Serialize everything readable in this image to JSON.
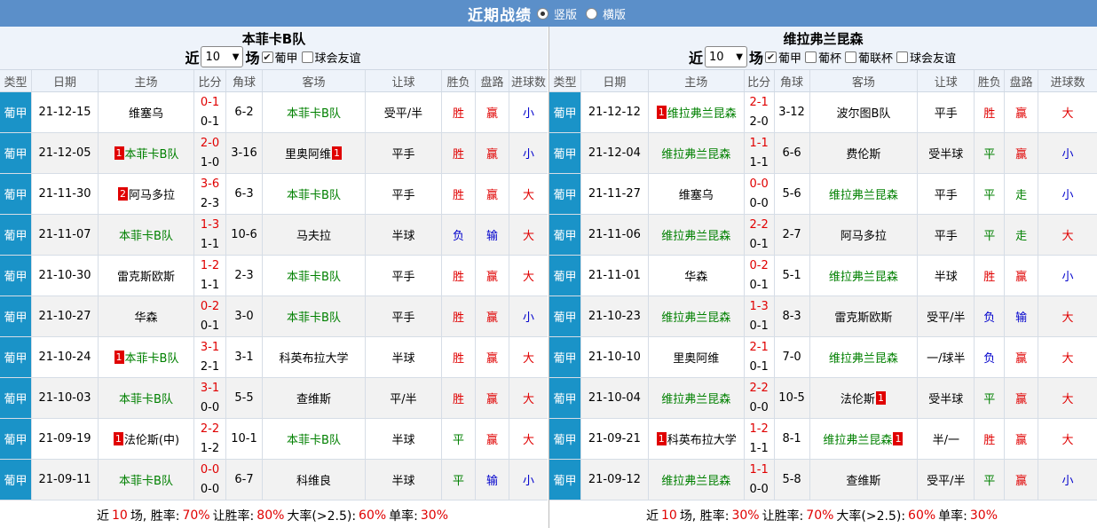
{
  "header": {
    "title": "近期战绩",
    "layout_options": [
      "竖版",
      "横版"
    ],
    "selected_layout": "竖版"
  },
  "colors": {
    "topbar": "#5b8fc9",
    "type_cell": "#1a93c8",
    "red": "#e00000",
    "green": "#008000",
    "blue": "#0000cc"
  },
  "columns": [
    "类型",
    "日期",
    "主场",
    "比分",
    "角球",
    "客场",
    "让球",
    "胜负",
    "盘路",
    "进球数"
  ],
  "left": {
    "team": "本菲卡B队",
    "prefix": "近",
    "count": "10",
    "suffix": "场",
    "filters": [
      {
        "label": "葡甲",
        "checked": true
      },
      {
        "label": "球会友谊",
        "checked": false
      }
    ],
    "rows": [
      {
        "type": "葡甲",
        "date": "21-12-15",
        "home": "维塞乌",
        "home_flag": "",
        "ht": "0-1",
        "ft": "0-1",
        "corner": "6-2",
        "away": "本菲卡B队",
        "away_flag": "",
        "handicap": "受平/半",
        "result": "胜",
        "pan": "赢",
        "goals": "小"
      },
      {
        "type": "葡甲",
        "date": "21-12-05",
        "home": "本菲卡B队",
        "home_flag": "1",
        "ht": "2-0",
        "ft": "1-0",
        "corner": "3-16",
        "away": "里奥阿维",
        "away_flag": "1",
        "handicap": "平手",
        "result": "胜",
        "pan": "赢",
        "goals": "小"
      },
      {
        "type": "葡甲",
        "date": "21-11-30",
        "home": "阿马多拉",
        "home_flag": "2",
        "ht": "3-6",
        "ft": "2-3",
        "corner": "6-3",
        "away": "本菲卡B队",
        "away_flag": "",
        "handicap": "平手",
        "result": "胜",
        "pan": "赢",
        "goals": "大"
      },
      {
        "type": "葡甲",
        "date": "21-11-07",
        "home": "本菲卡B队",
        "home_flag": "",
        "ht": "1-3",
        "ft": "1-1",
        "corner": "10-6",
        "away": "马夫拉",
        "away_flag": "",
        "handicap": "半球",
        "result": "负",
        "pan": "输",
        "goals": "大"
      },
      {
        "type": "葡甲",
        "date": "21-10-30",
        "home": "雷克斯欧斯",
        "home_flag": "",
        "ht": "1-2",
        "ft": "1-1",
        "corner": "2-3",
        "away": "本菲卡B队",
        "away_flag": "",
        "handicap": "平手",
        "result": "胜",
        "pan": "赢",
        "goals": "大"
      },
      {
        "type": "葡甲",
        "date": "21-10-27",
        "home": "华森",
        "home_flag": "",
        "ht": "0-2",
        "ft": "0-1",
        "corner": "3-0",
        "away": "本菲卡B队",
        "away_flag": "",
        "handicap": "平手",
        "result": "胜",
        "pan": "赢",
        "goals": "小"
      },
      {
        "type": "葡甲",
        "date": "21-10-24",
        "home": "本菲卡B队",
        "home_flag": "1",
        "ht": "3-1",
        "ft": "2-1",
        "corner": "3-1",
        "away": "科英布拉大学",
        "away_flag": "",
        "handicap": "半球",
        "result": "胜",
        "pan": "赢",
        "goals": "大"
      },
      {
        "type": "葡甲",
        "date": "21-10-03",
        "home": "本菲卡B队",
        "home_flag": "",
        "ht": "3-1",
        "ft": "0-0",
        "corner": "5-5",
        "away": "查维斯",
        "away_flag": "",
        "handicap": "平/半",
        "result": "胜",
        "pan": "赢",
        "goals": "大"
      },
      {
        "type": "葡甲",
        "date": "21-09-19",
        "home": "法伦斯(中)",
        "home_flag": "1",
        "ht": "2-2",
        "ft": "1-2",
        "corner": "10-1",
        "away": "本菲卡B队",
        "away_flag": "",
        "handicap": "半球",
        "result": "平",
        "pan": "赢",
        "goals": "大"
      },
      {
        "type": "葡甲",
        "date": "21-09-11",
        "home": "本菲卡B队",
        "home_flag": "",
        "ht": "0-0",
        "ft": "0-0",
        "corner": "6-7",
        "away": "科维良",
        "away_flag": "",
        "handicap": "半球",
        "result": "平",
        "pan": "输",
        "goals": "小"
      }
    ],
    "summary": {
      "p1": "近",
      "n": "10",
      "p2": "场, 胜率:",
      "win": "70%",
      "p3": "让胜率:",
      "hwin": "80%",
      "p4": "大率(>2.5):",
      "big": "60%",
      "p5": "单率:",
      "odd": "30%"
    }
  },
  "right": {
    "team": "维拉弗兰昆森",
    "prefix": "近",
    "count": "10",
    "suffix": "场",
    "filters": [
      {
        "label": "葡甲",
        "checked": true
      },
      {
        "label": "葡杯",
        "checked": false
      },
      {
        "label": "葡联杯",
        "checked": false
      },
      {
        "label": "球会友谊",
        "checked": false
      }
    ],
    "rows": [
      {
        "type": "葡甲",
        "date": "21-12-12",
        "home": "维拉弗兰昆森",
        "home_flag": "1",
        "ht": "2-1",
        "ft": "2-0",
        "corner": "3-12",
        "away": "波尔图B队",
        "away_flag": "",
        "handicap": "平手",
        "result": "胜",
        "pan": "赢",
        "goals": "大"
      },
      {
        "type": "葡甲",
        "date": "21-12-04",
        "home": "维拉弗兰昆森",
        "home_flag": "",
        "ht": "1-1",
        "ft": "1-1",
        "corner": "6-6",
        "away": "费伦斯",
        "away_flag": "",
        "handicap": "受半球",
        "result": "平",
        "pan": "赢",
        "goals": "小"
      },
      {
        "type": "葡甲",
        "date": "21-11-27",
        "home": "维塞乌",
        "home_flag": "",
        "ht": "0-0",
        "ft": "0-0",
        "corner": "5-6",
        "away": "维拉弗兰昆森",
        "away_flag": "",
        "handicap": "平手",
        "result": "平",
        "pan": "走",
        "goals": "小"
      },
      {
        "type": "葡甲",
        "date": "21-11-06",
        "home": "维拉弗兰昆森",
        "home_flag": "",
        "ht": "2-2",
        "ft": "0-1",
        "corner": "2-7",
        "away": "阿马多拉",
        "away_flag": "",
        "handicap": "平手",
        "result": "平",
        "pan": "走",
        "goals": "大"
      },
      {
        "type": "葡甲",
        "date": "21-11-01",
        "home": "华森",
        "home_flag": "",
        "ht": "0-2",
        "ft": "0-1",
        "corner": "5-1",
        "away": "维拉弗兰昆森",
        "away_flag": "",
        "handicap": "半球",
        "result": "胜",
        "pan": "赢",
        "goals": "小"
      },
      {
        "type": "葡甲",
        "date": "21-10-23",
        "home": "维拉弗兰昆森",
        "home_flag": "",
        "ht": "1-3",
        "ft": "0-1",
        "corner": "8-3",
        "away": "雷克斯欧斯",
        "away_flag": "",
        "handicap": "受平/半",
        "result": "负",
        "pan": "输",
        "goals": "大"
      },
      {
        "type": "葡甲",
        "date": "21-10-10",
        "home": "里奥阿维",
        "home_flag": "",
        "ht": "2-1",
        "ft": "0-1",
        "corner": "7-0",
        "away": "维拉弗兰昆森",
        "away_flag": "",
        "handicap": "一/球半",
        "result": "负",
        "pan": "赢",
        "goals": "大"
      },
      {
        "type": "葡甲",
        "date": "21-10-04",
        "home": "维拉弗兰昆森",
        "home_flag": "",
        "ht": "2-2",
        "ft": "0-0",
        "corner": "10-5",
        "away": "法伦斯",
        "away_flag": "1",
        "handicap": "受半球",
        "result": "平",
        "pan": "赢",
        "goals": "大"
      },
      {
        "type": "葡甲",
        "date": "21-09-21",
        "home": "科英布拉大学",
        "home_flag": "1",
        "ht": "1-2",
        "ft": "1-1",
        "corner": "8-1",
        "away": "维拉弗兰昆森",
        "away_flag": "1",
        "handicap": "半/一",
        "result": "胜",
        "pan": "赢",
        "goals": "大"
      },
      {
        "type": "葡甲",
        "date": "21-09-12",
        "home": "维拉弗兰昆森",
        "home_flag": "",
        "ht": "1-1",
        "ft": "0-0",
        "corner": "5-8",
        "away": "查维斯",
        "away_flag": "",
        "handicap": "受平/半",
        "result": "平",
        "pan": "赢",
        "goals": "小"
      }
    ],
    "summary": {
      "p1": "近",
      "n": "10",
      "p2": "场, 胜率:",
      "win": "30%",
      "p3": "让胜率:",
      "hwin": "70%",
      "p4": "大率(>2.5):",
      "big": "60%",
      "p5": "单率:",
      "odd": "30%"
    }
  }
}
